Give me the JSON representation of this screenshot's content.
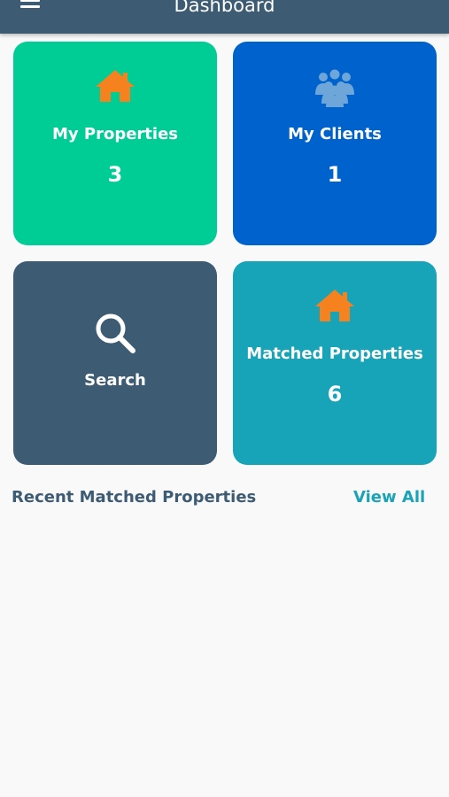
{
  "appbar": {
    "title": "Dashboard",
    "menu_icon": "hamburger-menu-icon"
  },
  "cards": [
    {
      "label": "My Properties",
      "count": "3",
      "icon": "home-icon",
      "color": "#00cc96",
      "icon_color": "#f5821f"
    },
    {
      "label": "My Clients",
      "count": "1",
      "icon": "users-icon",
      "color": "#0062cc",
      "icon_color": "#6ea6da"
    },
    {
      "label": "Search",
      "icon": "search-icon",
      "color": "#3d5c74",
      "icon_color": "#ffffff"
    },
    {
      "label": "Matched Properties",
      "count": "6",
      "icon": "home-icon",
      "color": "#18a4b8",
      "icon_color": "#f5821f"
    }
  ],
  "recent": {
    "title": "Recent Matched Properties",
    "view_all": "View All"
  },
  "colors": {
    "appbar": "#3d5c74",
    "background": "#f9f9fa",
    "accent": "#1aa3b7"
  }
}
